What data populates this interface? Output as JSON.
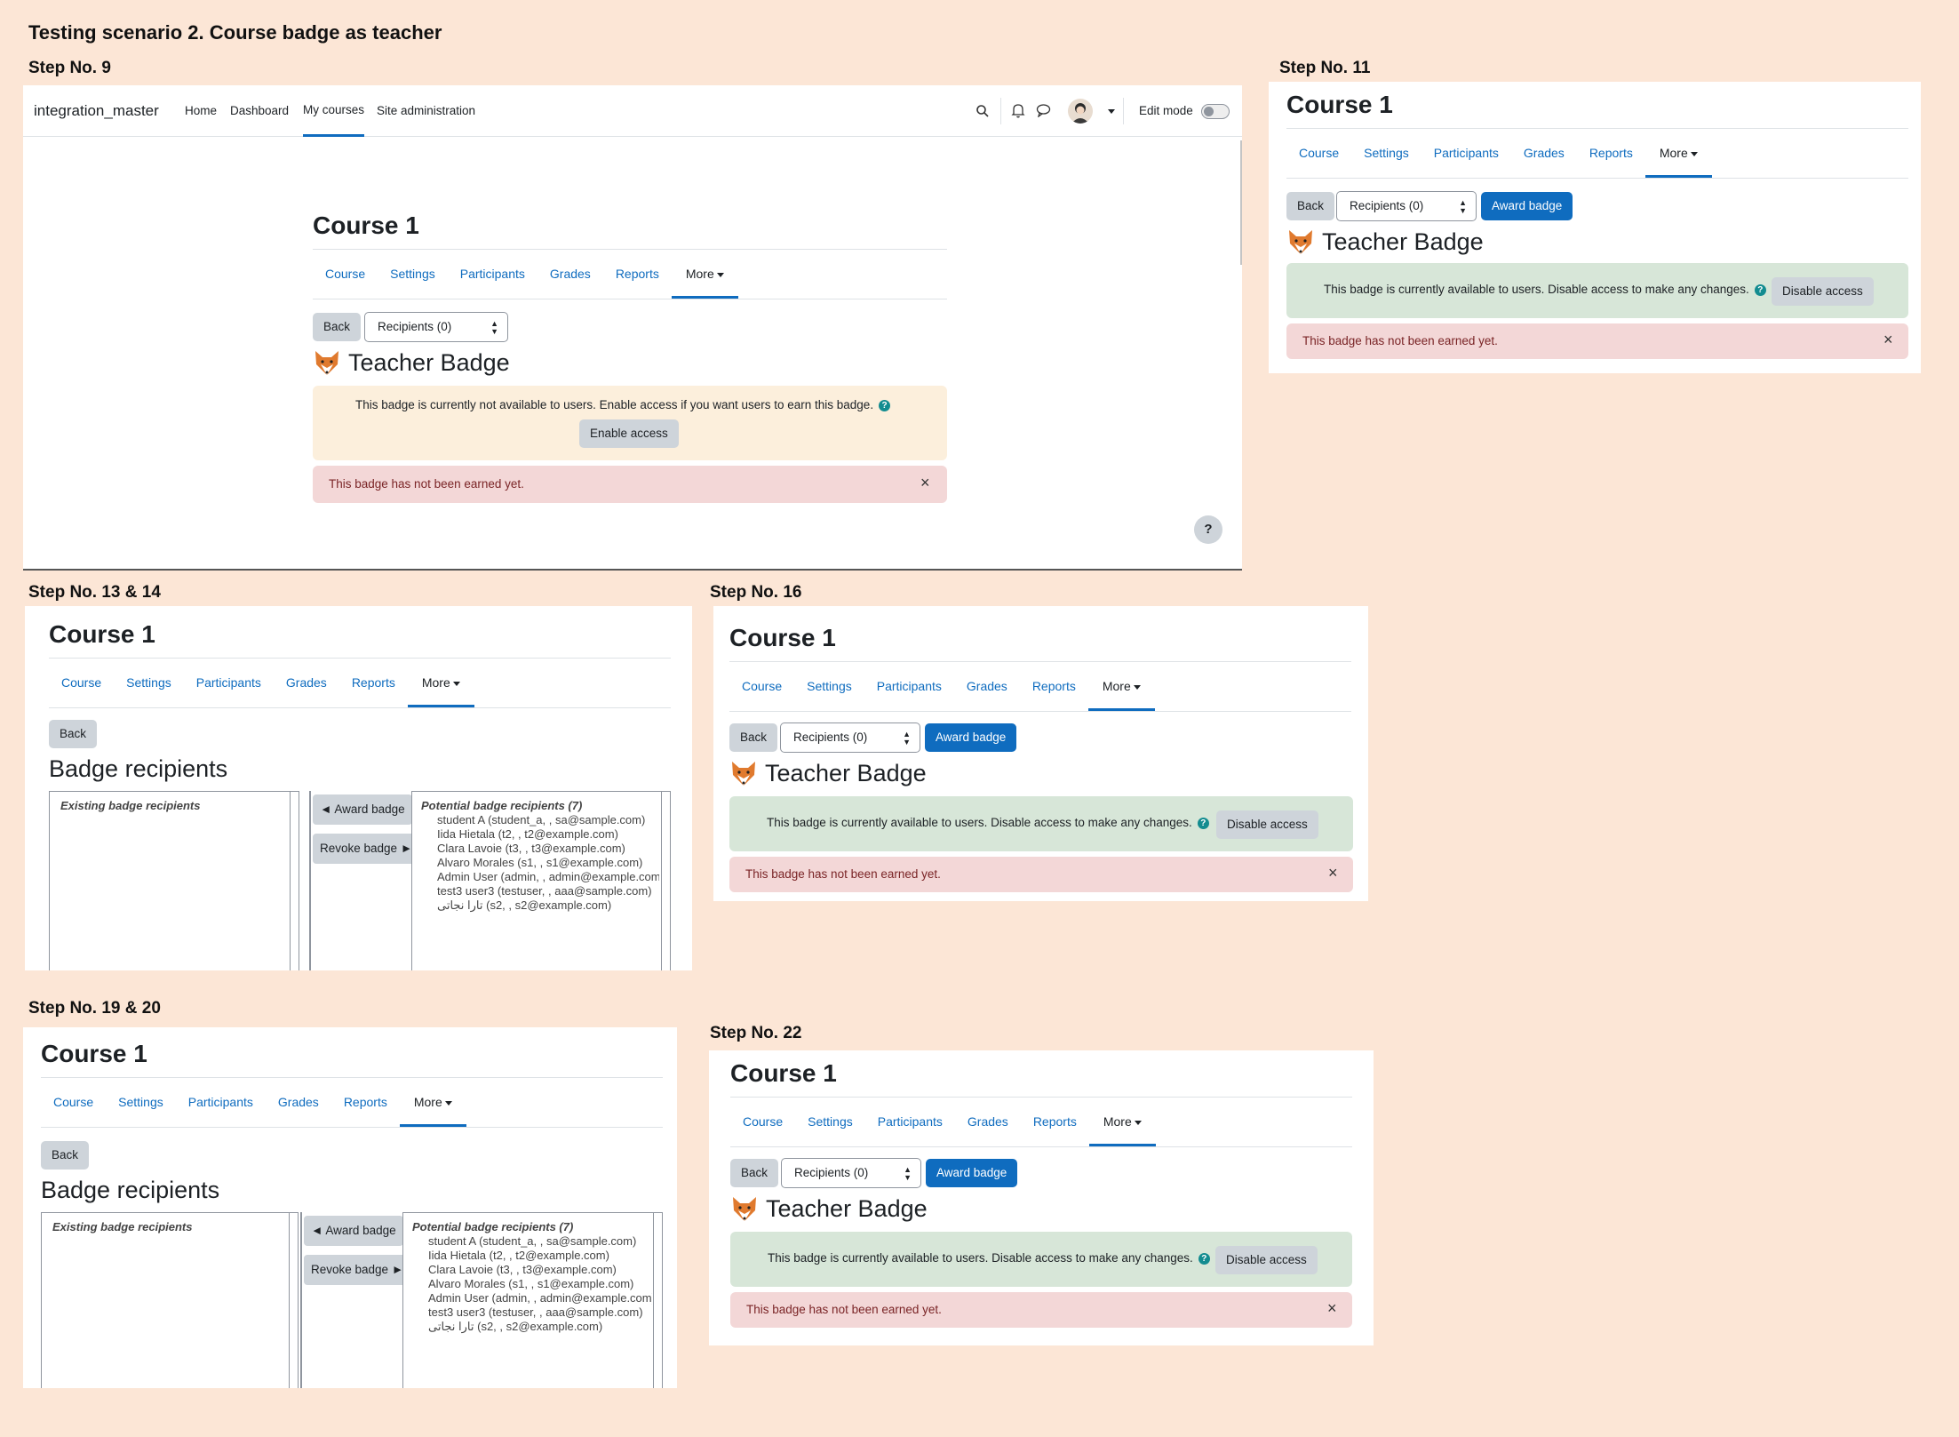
{
  "document": {
    "title": "Testing scenario 2. Course badge as teacher"
  },
  "steps": {
    "s9": "Step No. 9",
    "s11": "Step No. 11",
    "s13": "Step No. 13 & 14",
    "s16": "Step No. 16",
    "s19": "Step No. 19 & 20",
    "s22": "Step No. 22"
  },
  "navbar": {
    "site_name": "integration_master",
    "links": [
      "Home",
      "Dashboard",
      "My courses",
      "Site administration"
    ],
    "edit_mode": "Edit mode"
  },
  "course": {
    "title": "Course 1",
    "tabs": [
      "Course",
      "Settings",
      "Participants",
      "Grades",
      "Reports",
      "More"
    ]
  },
  "controls": {
    "back": "Back",
    "recipients": "Recipients (0)",
    "award_badge": "Award badge",
    "enable_access": "Enable access",
    "disable_access": "Disable access",
    "help": "?"
  },
  "badge": {
    "name": "Teacher Badge",
    "not_available": "This badge is currently not available to users. Enable access if you want users to earn this badge.",
    "available": "This badge is currently available to users. Disable access to make any changes.",
    "not_earned": "This badge has not been earned yet."
  },
  "recipients_page": {
    "heading": "Badge recipients",
    "existing": "Existing badge recipients",
    "potential": "Potential badge recipients (7)",
    "award": "◄ Award badge",
    "revoke": "Revoke badge ►",
    "users": [
      "student A (student_a, , sa@sample.com)",
      "Iida Hietala (t2, , t2@example.com)",
      "Clara Lavoie (t3, , t3@example.com)",
      "Alvaro Morales (s1, , s1@example.com)",
      "Admin User (admin, , admin@example.com)",
      "test3 user3 (testuser, , aaa@sample.com)",
      "تارا نجاتی (s2, , s2@example.com)"
    ]
  },
  "colors": {
    "page_bg": "#fce6d6",
    "primary": "#0f6cbf",
    "warning_bg": "#fcefdc",
    "success_bg": "#d7e6d8",
    "danger_bg": "#f3d7d7",
    "danger_text": "#7a2426"
  }
}
